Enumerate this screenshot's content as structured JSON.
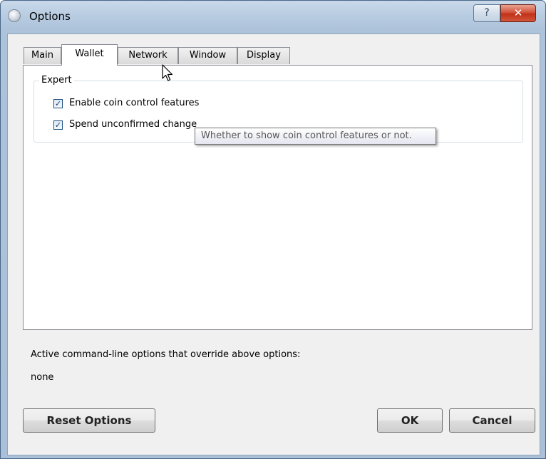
{
  "window": {
    "title": "Options",
    "help_glyph": "?",
    "close_glyph": "✕"
  },
  "tabs": [
    {
      "label": "Main",
      "active": false
    },
    {
      "label": "Wallet",
      "active": true
    },
    {
      "label": "Network",
      "active": false
    },
    {
      "label": "Window",
      "active": false
    },
    {
      "label": "Display",
      "active": false
    }
  ],
  "wallet": {
    "group_title": "Expert",
    "options": [
      {
        "label": "Enable coin control features",
        "checked": true
      },
      {
        "label": "Spend unconfirmed change",
        "checked": true
      }
    ]
  },
  "tooltip": {
    "text": "Whether to show coin control features or not."
  },
  "overrides": {
    "label": "Active command-line options that override above options:",
    "value": "none"
  },
  "buttons": {
    "reset": "Reset Options",
    "ok": "OK",
    "cancel": "Cancel"
  },
  "icons": {
    "app": "app-icon",
    "help": "help-icon",
    "close": "close-icon",
    "check": "checkmark-icon",
    "cursor": "mouse-pointer-icon"
  },
  "colors": {
    "title_bar": "#b9cde2",
    "close_button": "#c03217",
    "checkbox_border": "#1c5180",
    "tooltip_text": "#575757"
  }
}
